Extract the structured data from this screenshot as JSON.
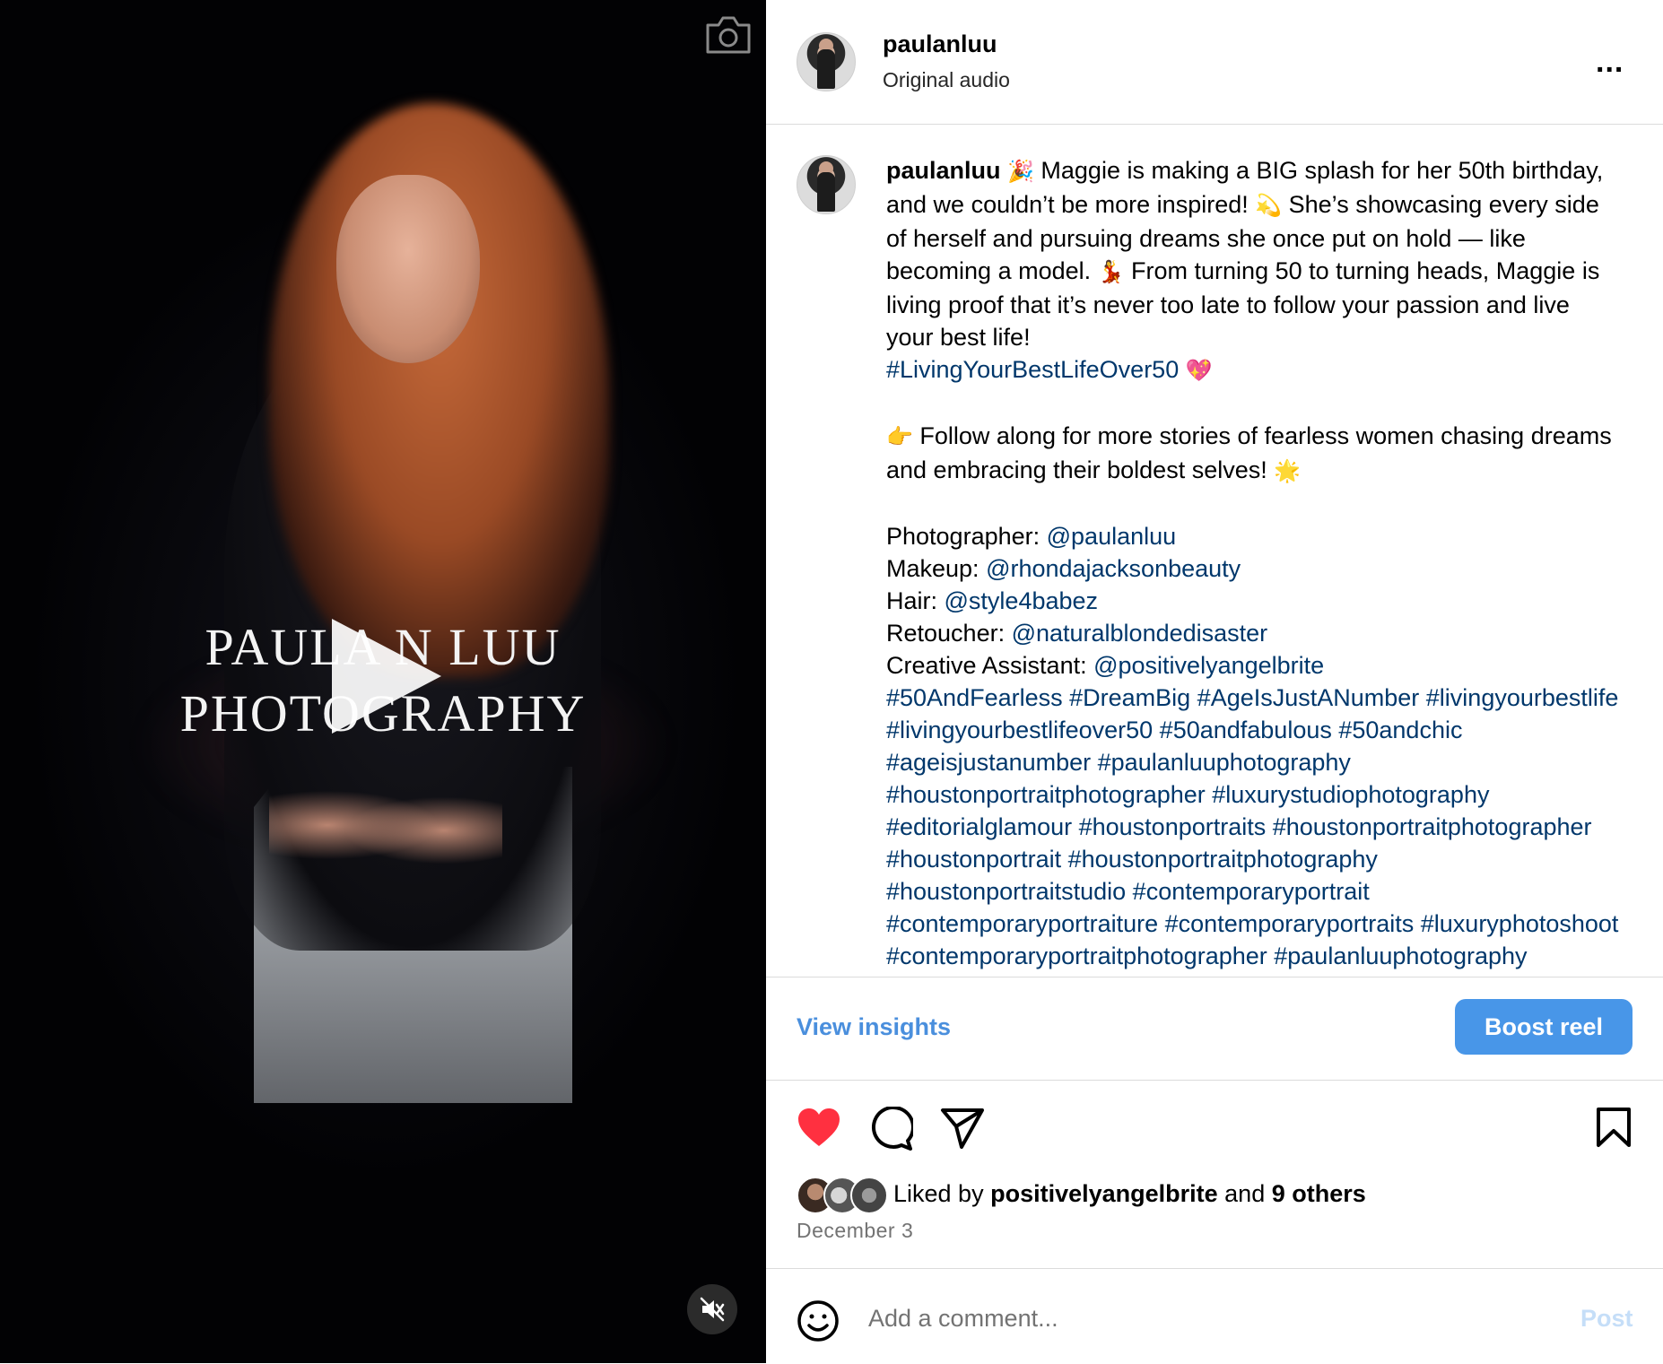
{
  "media": {
    "watermark_line1": "PAULA N LUU",
    "watermark_line2": "PHOTOGRAPHY",
    "icons": [
      "camera-icon",
      "play-icon",
      "muted-speaker-icon"
    ]
  },
  "header": {
    "username": "paulanluu",
    "audio": "Original audio",
    "more": "..."
  },
  "caption": {
    "username": "paulanluu",
    "emoji_party": "🎉",
    "p1": " Maggie is making a BIG splash for her 50th birthday, and we couldn’t be more inspired! ",
    "emoji_dizzy": "💫",
    "p2": " She’s showcasing every side of herself and pursuing dreams she once put on hold — like becoming a model. ",
    "emoji_dancer": "💃",
    "p3": " From turning 50 to turning heads, Maggie is living proof that it’s never too late to follow your passion and live your best life!",
    "tag_main": "#LivingYourBestLifeOver50",
    "emoji_heart": "💖",
    "emoji_point": "👉",
    "p4": " Follow along for more stories of fearless women chasing dreams and embracing their boldest selves! ",
    "emoji_star": "🌟",
    "credits": [
      {
        "label": "Photographer: ",
        "handle": "@paulanluu"
      },
      {
        "label": "Makeup: ",
        "handle": "@rhondajacksonbeauty"
      },
      {
        "label": "Hair: ",
        "handle": "@style4babez"
      },
      {
        "label": "Retoucher: ",
        "handle": "@naturalblondedisaster"
      },
      {
        "label": "Creative Assistant: ",
        "handle": "@positivelyangelbrite"
      }
    ],
    "hashtags": "#50AndFearless #DreamBig #AgeIsJustANumber #livingyourbestlife #livingyourbestlifeover50 #50andfabulous #50andchic #ageisjustanumber #paulanluuphotography #houstonportraitphotographer #luxurystudiophotography #editorialglamour #houstonportraits #houstonportraitphotographer #houstonportrait #houstonportraitphotography #houstonportraitstudio #contemporaryportrait #contemporaryportraiture #contemporaryportraits #luxuryphotoshoot #contemporaryportraitphotographer #paulanluuphotography"
  },
  "insights": {
    "view_label": "View insights",
    "boost_label": "Boost reel"
  },
  "actions": {
    "liked_prefix": "Liked by ",
    "liked_user": "positivelyangelbrite",
    "liked_mid": " and ",
    "liked_others": "9 others",
    "date": "December 3"
  },
  "comment": {
    "placeholder": "Add a comment...",
    "post_label": "Post"
  },
  "colors": {
    "link": "#00376b",
    "accent_blue": "#4896e8",
    "heart_red": "#ff3040",
    "post_disabled": "#c5def8"
  }
}
